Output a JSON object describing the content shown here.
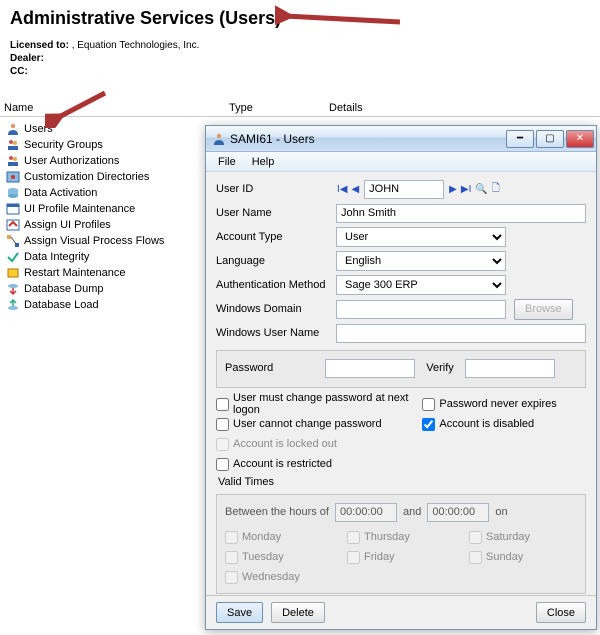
{
  "header": {
    "title": "Administrative Services (Users)",
    "licensed_to_label": "Licensed to:",
    "licensed_to_value": ", Equation Technologies, Inc.",
    "dealer_label": "Dealer:",
    "cc_label": "CC:"
  },
  "columns": {
    "name": "Name",
    "type": "Type",
    "details": "Details"
  },
  "sidebar": {
    "items": [
      {
        "label": "Users",
        "icon": "person-icon"
      },
      {
        "label": "Security Groups",
        "icon": "people-key-icon"
      },
      {
        "label": "User Authorizations",
        "icon": "people-key-icon"
      },
      {
        "label": "Customization Directories",
        "icon": "folder-gear-icon"
      },
      {
        "label": "Data Activation",
        "icon": "database-icon"
      },
      {
        "label": "UI Profile Maintenance",
        "icon": "profile-icon"
      },
      {
        "label": "Assign UI Profiles",
        "icon": "profile-assign-icon"
      },
      {
        "label": "Assign Visual Process Flows",
        "icon": "flow-icon"
      },
      {
        "label": "Data Integrity",
        "icon": "check-icon"
      },
      {
        "label": "Restart Maintenance",
        "icon": "restart-icon"
      },
      {
        "label": "Database Dump",
        "icon": "db-down-icon"
      },
      {
        "label": "Database Load",
        "icon": "db-up-icon"
      }
    ]
  },
  "dialog": {
    "title": "SAMI61 - Users",
    "menu": {
      "file": "File",
      "help": "Help"
    },
    "fields": {
      "user_id_label": "User ID",
      "user_id_value": "JOHN",
      "user_name_label": "User Name",
      "user_name_value": "John Smith",
      "account_type_label": "Account Type",
      "account_type_value": "User",
      "language_label": "Language",
      "language_value": "English",
      "auth_method_label": "Authentication Method",
      "auth_method_value": "Sage 300 ERP",
      "win_domain_label": "Windows Domain",
      "win_domain_value": "",
      "browse_label": "Browse",
      "win_user_label": "Windows User Name",
      "win_user_value": "",
      "password_label": "Password",
      "password_value": "",
      "verify_label": "Verify",
      "verify_value": ""
    },
    "checks": {
      "must_change": "User must change password at next logon",
      "cannot_change": "User cannot change password",
      "locked_out": "Account is locked out",
      "restricted": "Account is restricted",
      "never_expires": "Password never expires",
      "disabled": "Account is disabled"
    },
    "valid_times": {
      "title": "Valid Times",
      "between_label": "Between the hours of",
      "from_value": "00:00:00",
      "and_label": "and",
      "to_value": "00:00:00",
      "on_label": "on",
      "days": {
        "mon": "Monday",
        "tue": "Tuesday",
        "wed": "Wednesday",
        "thu": "Thursday",
        "fri": "Friday",
        "sat": "Saturday",
        "sun": "Sunday"
      }
    },
    "buttons": {
      "save": "Save",
      "delete": "Delete",
      "close": "Close"
    }
  }
}
